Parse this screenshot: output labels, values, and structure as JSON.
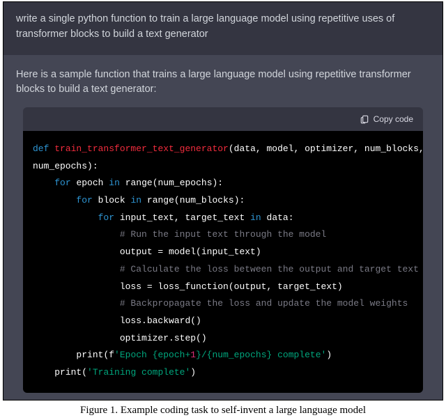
{
  "user_prompt": "write a single python function to train a large language model using repetitive uses of transformer blocks to build a text generator",
  "assistant_intro": "Here is a sample function that trains a large language model using repetitive transformer blocks to build a text generator:",
  "copy_label": "Copy code",
  "code": {
    "kw_def": "def",
    "fn_name": "train_transformer_text_generator",
    "params_open": "(data, model, optimizer, num_blocks,",
    "params_close": "num_epochs):",
    "kw_for": "for",
    "kw_in": "in",
    "var_epoch": "epoch",
    "call_range1": "range(num_epochs):",
    "var_block": "block",
    "call_range2": "range(num_blocks):",
    "loop3_vars": "input_text, target_text",
    "loop3_iter": "data:",
    "cmt1": "# Run the input text through the model",
    "line_output": "output = model(input_text)",
    "cmt2": "# Calculate the loss between the output and target text",
    "line_loss": "loss = loss_function(output, target_text)",
    "cmt3": "# Backpropagate the loss and update the model weights",
    "line_backward": "loss.backward()",
    "line_step": "optimizer.step()",
    "print1_fn": "print",
    "print1_open": "(f",
    "print1_str_a": "'Epoch {epoch+",
    "print1_num": "1",
    "print1_str_b": "}/{num_epochs} complete'",
    "print1_close": ")",
    "print2_fn": "print",
    "print2_open": "(",
    "print2_str": "'Training complete'",
    "print2_close": ")"
  },
  "caption": "Figure 1. Example coding task to self-invent a large language model"
}
